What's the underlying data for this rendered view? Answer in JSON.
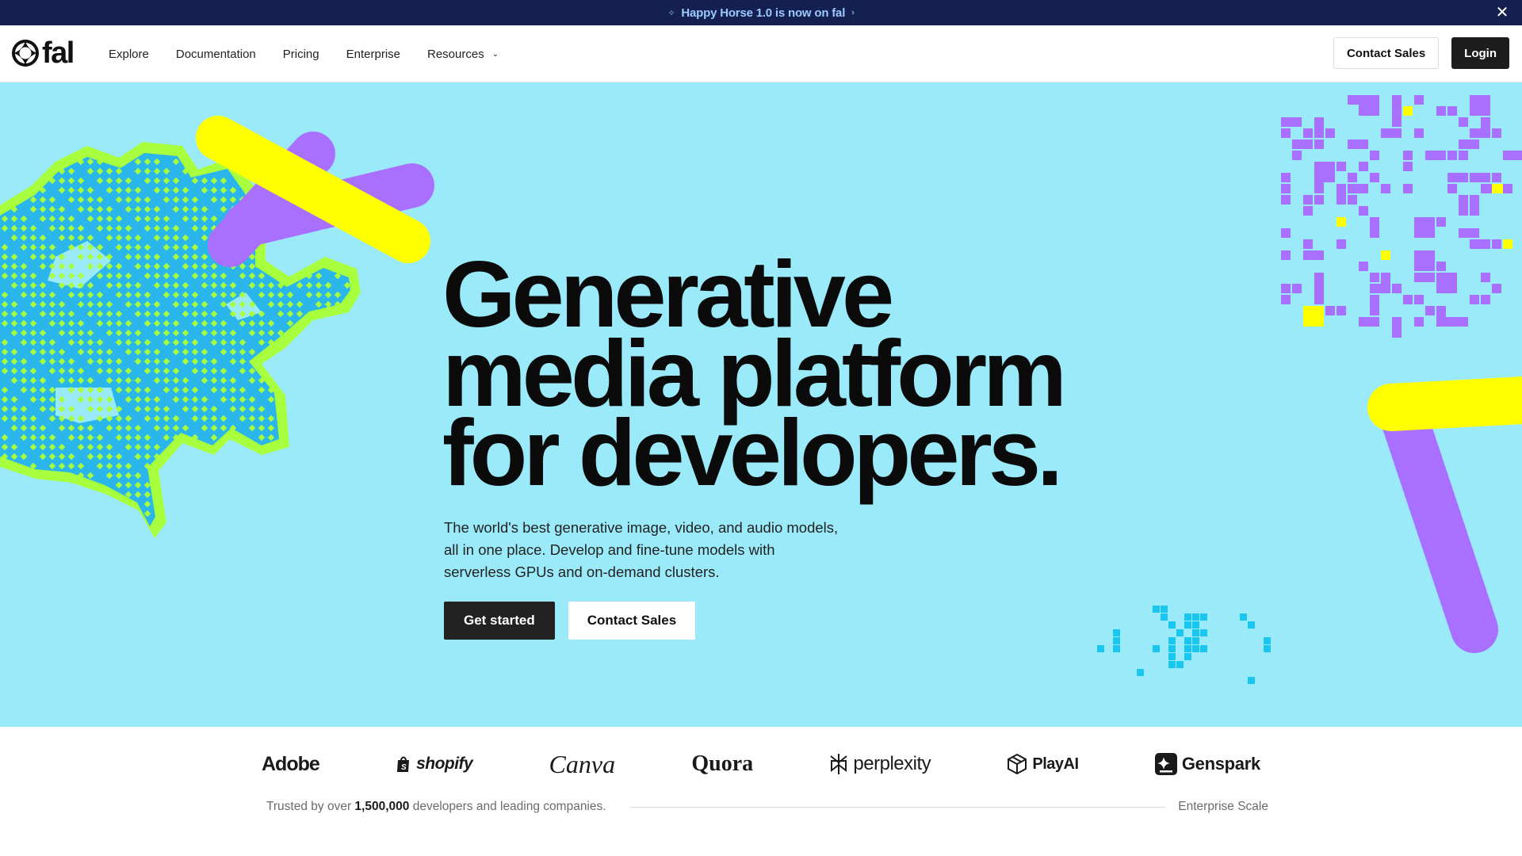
{
  "announcement": {
    "text": "Happy Horse 1.0 is now on fal",
    "lead_icon": "sparkle-icon",
    "trail_icon": "chevron-right-icon",
    "close_icon": "close-icon",
    "close_glyph": "✕"
  },
  "nav": {
    "logo_text": "fal",
    "links": [
      {
        "label": "Explore"
      },
      {
        "label": "Documentation"
      },
      {
        "label": "Pricing"
      },
      {
        "label": "Enterprise"
      },
      {
        "label": "Resources"
      }
    ],
    "contact_sales": "Contact Sales",
    "login": "Login"
  },
  "hero": {
    "title_lines": [
      "Generative",
      "media platform",
      "for developers."
    ],
    "subtitle": "The world's best generative image, video, and audio models, all in one place. Develop and fine-tune models with serverless GPUs and on-demand clusters.",
    "primary_cta": "Get started",
    "secondary_cta": "Contact Sales",
    "colors": {
      "background": "#9aeaf9",
      "yellow": "#ffff00",
      "purple": "#a970ff",
      "lime": "#a8ff3e",
      "cyan": "#19c6ee"
    }
  },
  "logos": {
    "brands": [
      "Adobe",
      "shopify",
      "Canva",
      "Quora",
      "perplexity",
      "PlayAI",
      "Genspark"
    ],
    "trust_prefix": "Trusted by over ",
    "trust_count": "1,500,000",
    "trust_suffix": " developers and leading companies.",
    "trust_right": "Enterprise Scale"
  }
}
